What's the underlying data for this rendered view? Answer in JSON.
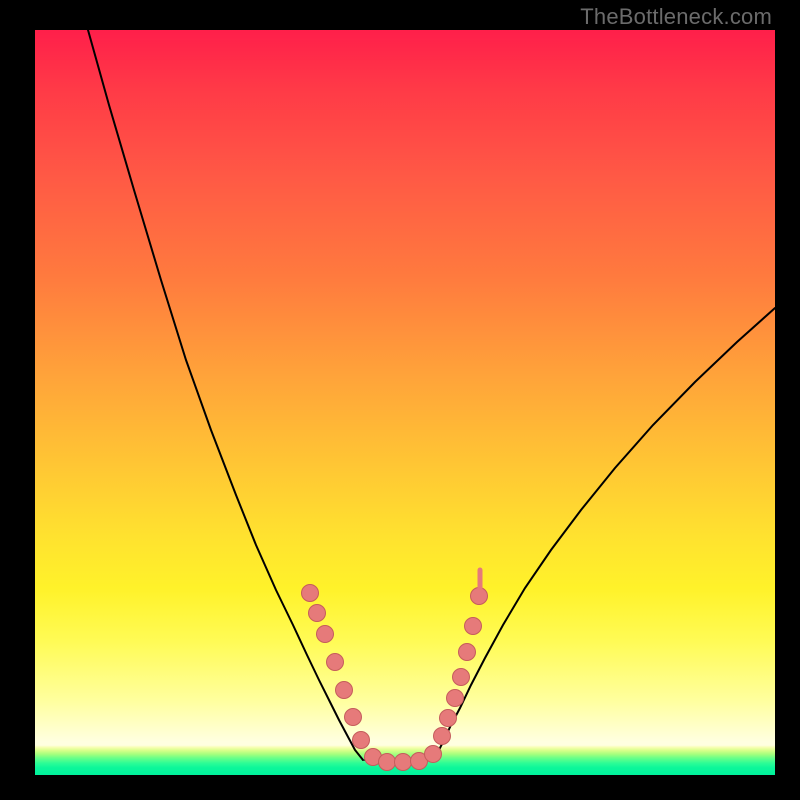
{
  "watermark": "TheBottleneck.com",
  "chart_data": {
    "type": "line",
    "title": "",
    "xlabel": "",
    "ylabel": "",
    "xlim": [
      0,
      740
    ],
    "ylim": [
      0,
      745
    ],
    "left_curve": [
      [
        53,
        0
      ],
      [
        74,
        75
      ],
      [
        99,
        160
      ],
      [
        126,
        250
      ],
      [
        151,
        330
      ],
      [
        176,
        400
      ],
      [
        201,
        465
      ],
      [
        221,
        515
      ],
      [
        241,
        560
      ],
      [
        258,
        595
      ],
      [
        272,
        625
      ],
      [
        284,
        650
      ],
      [
        295,
        672
      ],
      [
        304,
        690
      ],
      [
        312,
        705
      ],
      [
        320,
        720
      ],
      [
        328,
        730
      ]
    ],
    "flat_segment": [
      [
        330,
        730
      ],
      [
        396,
        730
      ]
    ],
    "right_curve": [
      [
        398,
        730
      ],
      [
        403,
        722
      ],
      [
        409,
        710
      ],
      [
        416,
        695
      ],
      [
        425,
        678
      ],
      [
        436,
        655
      ],
      [
        450,
        628
      ],
      [
        468,
        595
      ],
      [
        490,
        558
      ],
      [
        516,
        520
      ],
      [
        546,
        480
      ],
      [
        580,
        438
      ],
      [
        618,
        395
      ],
      [
        660,
        352
      ],
      [
        702,
        312
      ],
      [
        740,
        278
      ]
    ],
    "dots": [
      [
        275,
        563
      ],
      [
        282,
        583
      ],
      [
        290,
        604
      ],
      [
        300,
        632
      ],
      [
        309,
        660
      ],
      [
        318,
        687
      ],
      [
        326,
        710
      ],
      [
        338,
        727
      ],
      [
        352,
        732
      ],
      [
        368,
        732
      ],
      [
        384,
        731
      ],
      [
        398,
        724
      ],
      [
        407,
        706
      ],
      [
        413,
        688
      ],
      [
        420,
        668
      ],
      [
        426,
        647
      ],
      [
        432,
        622
      ],
      [
        438,
        596
      ],
      [
        444,
        566
      ]
    ],
    "right_tick": {
      "x": 445,
      "y_top": 540,
      "y_bot": 560
    }
  }
}
